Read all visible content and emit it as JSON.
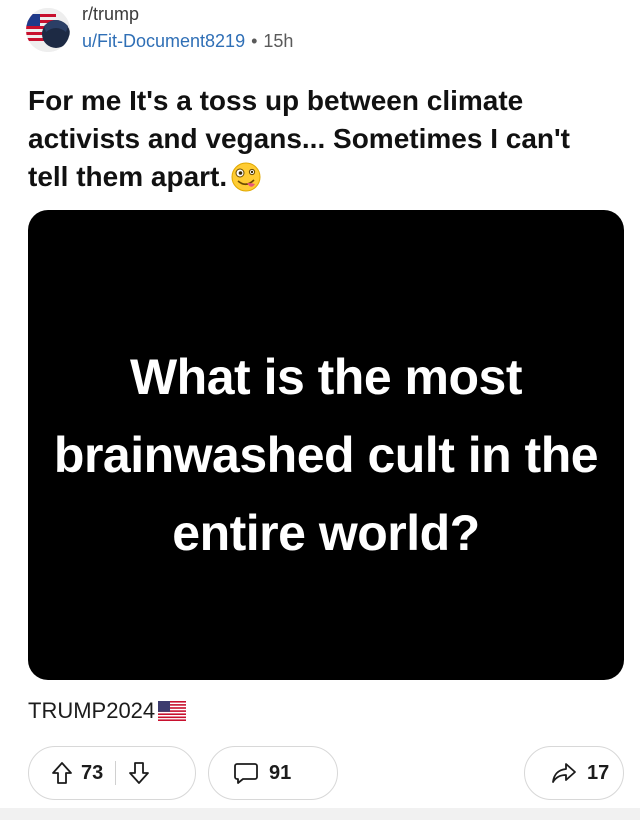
{
  "post": {
    "subreddit": "r/trump",
    "username": "u/Fit-Document8219",
    "separator": "•",
    "time": "15h",
    "title": "For me It's a toss up between climate activists and vegans... Sometimes I can't tell them apart.",
    "title_emoji": "zany-face-emoji",
    "image_text": "What is the most brainwashed cult in the entire world?",
    "caption": "TRUMP2024",
    "caption_icon": "us-flag-icon"
  },
  "actions": {
    "upvotes": "73",
    "comments": "91",
    "shares": "17"
  },
  "colors": {
    "username": "#2f6fb6",
    "image_bg": "#000000",
    "pill_border": "#d8d8d8"
  }
}
